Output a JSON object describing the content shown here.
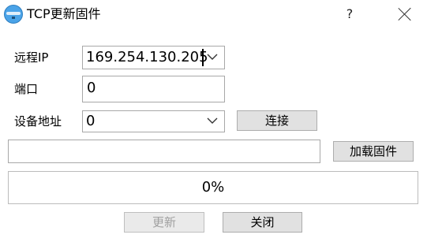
{
  "window": {
    "title": "TCP更新固件",
    "help_glyph": "?"
  },
  "form": {
    "remote_ip": {
      "label": "远程IP",
      "value": "169.254.130.205"
    },
    "port": {
      "label": "端口",
      "value": "0"
    },
    "device_address": {
      "label": "设备地址",
      "value": "0"
    },
    "connect_label": "连接",
    "firmware_path": {
      "value": ""
    },
    "load_firmware_label": "加载固件"
  },
  "progress": {
    "value": 0,
    "text": "0%"
  },
  "actions": {
    "update_label": "更新",
    "close_label": "关闭"
  },
  "icons": [
    "app-icon",
    "help-icon",
    "close-icon",
    "chevron-down-icon"
  ],
  "colors": {
    "app_icon": "#4aa3e8",
    "button_bg": "#e1e1e1",
    "progress_fill": "#06b025"
  }
}
